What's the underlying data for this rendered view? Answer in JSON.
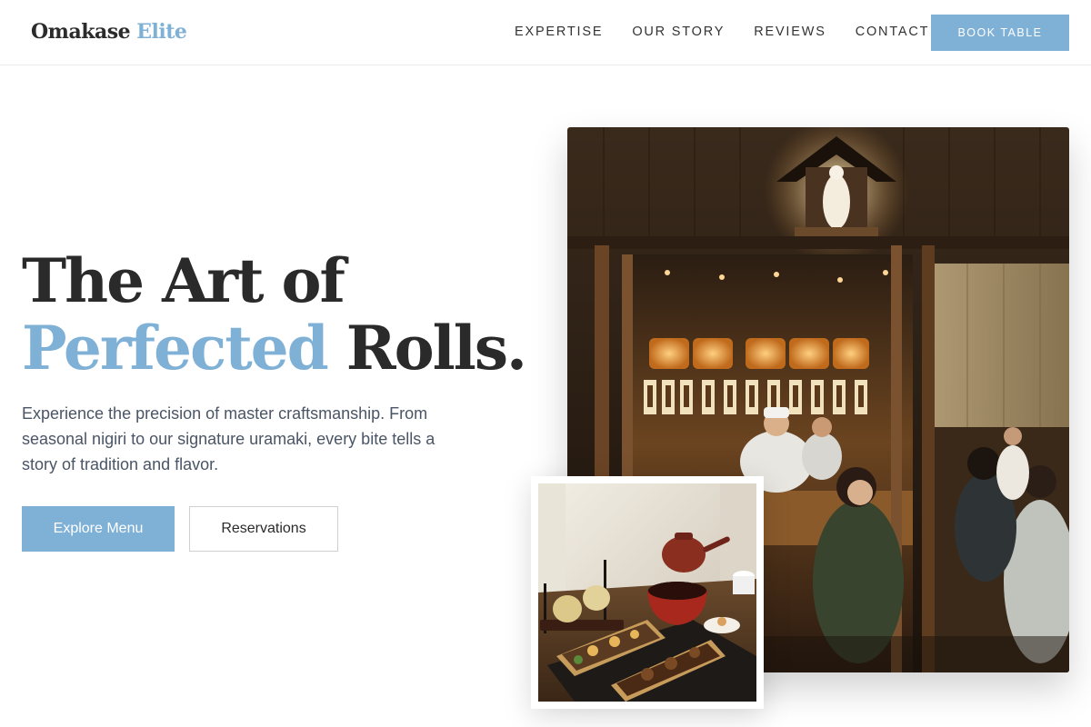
{
  "header": {
    "logo_main": "Omakase",
    "logo_accent": "Elite",
    "nav": [
      "EXPERTISE",
      "OUR STORY",
      "REVIEWS",
      "CONTACT"
    ],
    "book_label": "BOOK TABLE"
  },
  "hero": {
    "title_line1": "The Art of",
    "title_accent": "Perfected",
    "title_rest": " Rolls.",
    "description": "Experience the precision of master craftsmanship. From seasonal nigiri to our signature uramaki, every bite tells a story of tradition and flavor.",
    "primary_button": "Explore Menu",
    "secondary_button": "Reservations"
  },
  "images": {
    "main": "restaurant-interior-photo",
    "secondary": "bento-box-tea-photo"
  },
  "colors": {
    "accent": "#7fb0d6",
    "text": "#2a2a2a",
    "body_text": "#4a5566"
  }
}
